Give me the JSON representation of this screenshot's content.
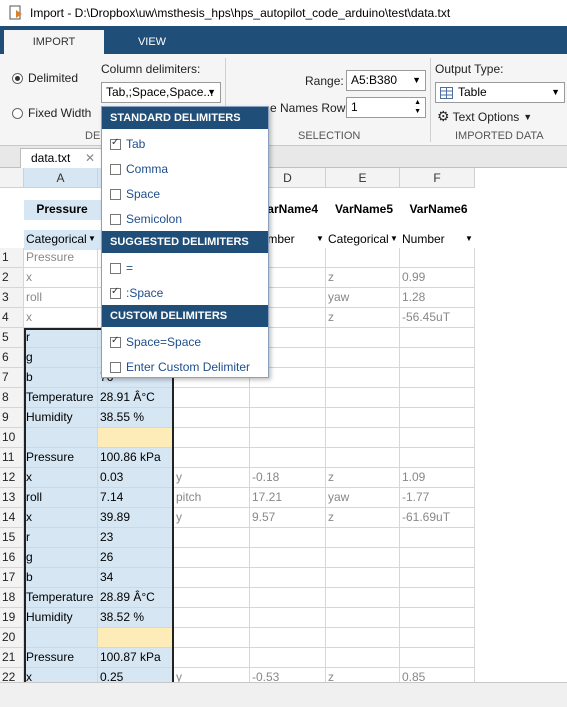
{
  "window": {
    "title": "Import - D:\\Dropbox\\uw\\msthesis_hps\\hps_autopilot_code_arduino\\test\\data.txt"
  },
  "tabs": [
    {
      "label": "IMPORT"
    },
    {
      "label": "VIEW"
    }
  ],
  "delimited": {
    "delimited_label": "Delimited",
    "fixed_width_label": "Fixed Width",
    "group_label": "DEL"
  },
  "column_delimiters": {
    "label": "Column delimiters:",
    "value": "Tab,;Space,Space..."
  },
  "selection": {
    "range_label": "Range:",
    "range_value": "A5:B380",
    "names_row_label": "e Names Row:",
    "names_row_value": "1",
    "group_label": "SELECTION"
  },
  "imported_data": {
    "output_type_label": "Output Type:",
    "output_type_value": "Table",
    "text_options_label": "Text Options",
    "group_label": "IMPORTED DATA"
  },
  "doc_tab": {
    "label": "data.txt"
  },
  "columns": [
    {
      "letter": "A",
      "name": "Pressure",
      "type": "Categorical"
    },
    {
      "letter": "B",
      "name": "",
      "type": ""
    },
    {
      "letter": "C",
      "name": "",
      "type": ""
    },
    {
      "letter": "D",
      "name": "VarName4",
      "type": "Number"
    },
    {
      "letter": "E",
      "name": "VarName5",
      "type": "Categorical"
    },
    {
      "letter": "F",
      "name": "VarName6",
      "type": "Number"
    }
  ],
  "rows": [
    [
      "1",
      "Pressure",
      "",
      "",
      "",
      "",
      ""
    ],
    [
      "2",
      "x",
      "",
      "",
      "02",
      "z",
      "0.99"
    ],
    [
      "3",
      "roll",
      "",
      "",
      "61",
      "yaw",
      "1.28"
    ],
    [
      "4",
      "x",
      "",
      "",
      "l",
      "z",
      "-56.45uT"
    ],
    [
      "5",
      "r",
      "",
      "",
      "",
      "",
      ""
    ],
    [
      "6",
      "g",
      "",
      "",
      "",
      "",
      ""
    ],
    [
      "7",
      "b",
      "76",
      "",
      "",
      "",
      ""
    ],
    [
      "8",
      "Temperature",
      "28.91 Â°C",
      "",
      "",
      "",
      ""
    ],
    [
      "9",
      "Humidity",
      "38.55 %",
      "",
      "",
      "",
      ""
    ],
    [
      "10",
      "",
      "",
      "",
      "",
      "",
      ""
    ],
    [
      "11",
      "Pressure",
      "100.86 kPa",
      "",
      "",
      "",
      ""
    ],
    [
      "12",
      "x",
      "0.03",
      "y",
      "-0.18",
      "z",
      "1.09"
    ],
    [
      "13",
      "roll",
      "7.14",
      "pitch",
      "17.21",
      "yaw",
      "-1.77"
    ],
    [
      "14",
      "x",
      "39.89",
      "y",
      "9.57",
      "z",
      "-61.69uT"
    ],
    [
      "15",
      "r",
      "23",
      "",
      "",
      "",
      ""
    ],
    [
      "16",
      "g",
      "26",
      "",
      "",
      "",
      ""
    ],
    [
      "17",
      "b",
      "34",
      "",
      "",
      "",
      ""
    ],
    [
      "18",
      "Temperature",
      "28.89 Â°C",
      "",
      "",
      "",
      ""
    ],
    [
      "19",
      "Humidity",
      "38.52 %",
      "",
      "",
      "",
      ""
    ],
    [
      "20",
      "",
      "",
      "",
      "",
      "",
      ""
    ],
    [
      "21",
      "Pressure",
      "100.87 kPa",
      "",
      "",
      "",
      ""
    ],
    [
      "22",
      "x",
      "0.25",
      "y",
      "-0.53",
      "z",
      "0.85"
    ]
  ],
  "delimiter_menu": {
    "standard_header": "STANDARD DELIMITERS",
    "standard": [
      {
        "label": "Tab",
        "checked": true
      },
      {
        "label": "Comma",
        "checked": false
      },
      {
        "label": "Space",
        "checked": false
      },
      {
        "label": "Semicolon",
        "checked": false
      }
    ],
    "suggested_header": "SUGGESTED DELIMITERS",
    "suggested": [
      {
        "label": "=",
        "checked": false
      },
      {
        "label": ":Space",
        "checked": true
      }
    ],
    "custom_header": "CUSTOM DELIMITERS",
    "custom": [
      {
        "label": "Space=Space",
        "checked": true
      },
      {
        "label": "Enter Custom Delimiter",
        "checked": false
      }
    ]
  },
  "colors": {
    "accent": "#1f4e79",
    "selection": "#d6e6f3",
    "warning": "#fdebb8"
  }
}
